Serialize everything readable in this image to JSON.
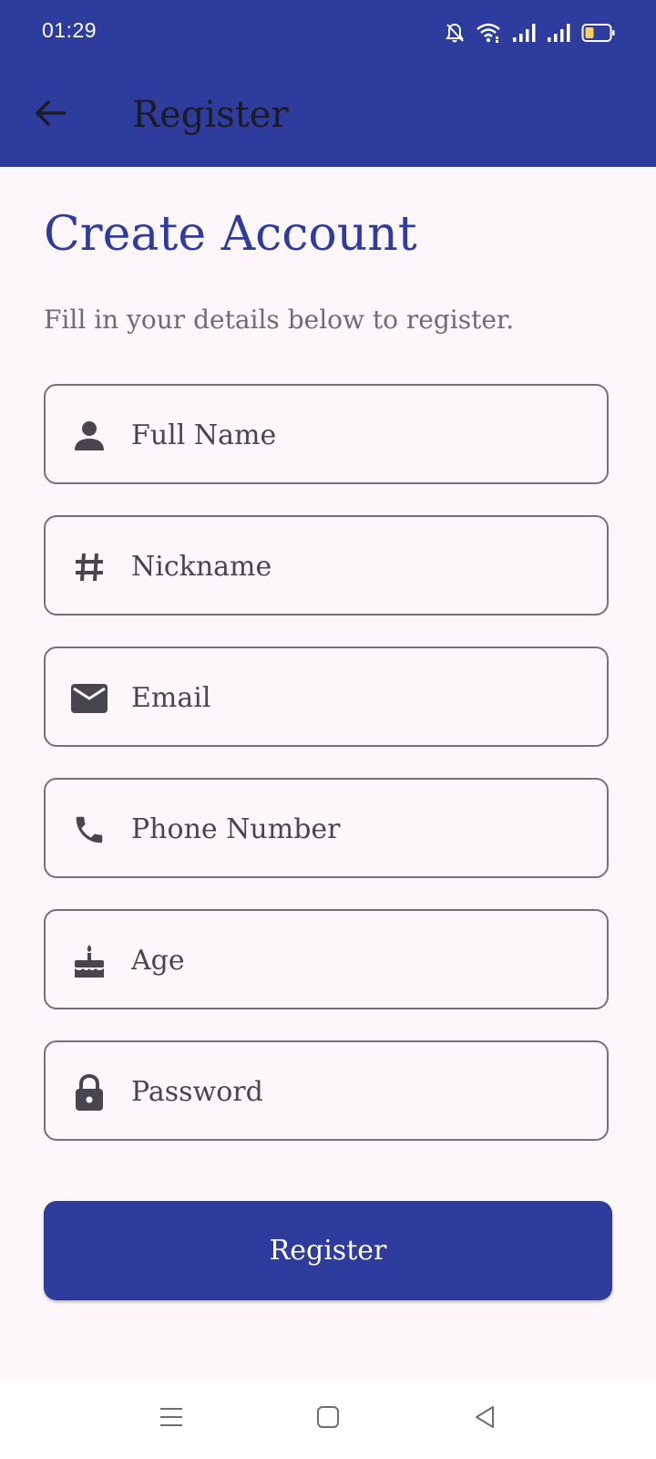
{
  "status_bar": {
    "time": "01:29",
    "icons": [
      "bell-off-icon",
      "wifi-icon",
      "signal-icon",
      "signal-icon",
      "battery-icon"
    ]
  },
  "app_bar": {
    "back_icon": "arrow-left-icon",
    "title": "Register"
  },
  "form": {
    "heading": "Create Account",
    "subtitle": "Fill in your details below to register.",
    "fields": [
      {
        "icon": "person-icon",
        "placeholder": "Full Name",
        "value": ""
      },
      {
        "icon": "hash-icon",
        "placeholder": "Nickname",
        "value": ""
      },
      {
        "icon": "mail-icon",
        "placeholder": "Email",
        "value": ""
      },
      {
        "icon": "phone-icon",
        "placeholder": "Phone Number",
        "value": ""
      },
      {
        "icon": "cake-icon",
        "placeholder": "Age",
        "value": ""
      },
      {
        "icon": "lock-icon",
        "placeholder": "Password",
        "value": ""
      }
    ],
    "submit_label": "Register"
  },
  "nav_bar": {
    "icons": [
      "menu-icon",
      "home-square-icon",
      "back-triangle-icon"
    ]
  },
  "colors": {
    "primary": "#2e3c9d",
    "background": "#fdf7fc",
    "outline": "#75707b",
    "icon": "#48454f",
    "battery_fill": "#f5d35c"
  }
}
